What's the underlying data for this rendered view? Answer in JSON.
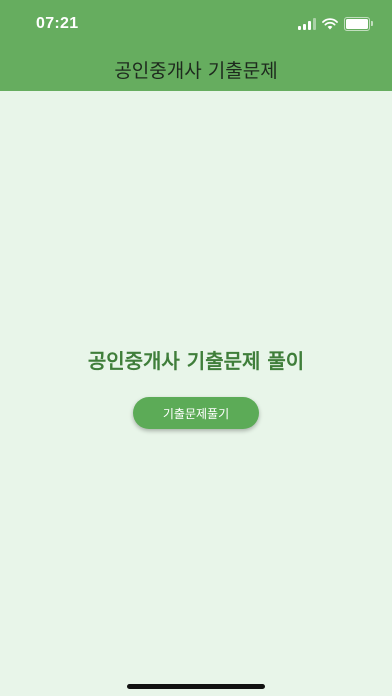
{
  "status_bar": {
    "time": "07:21",
    "icons": [
      "cellular-signal-icon",
      "wifi-icon",
      "battery-icon"
    ]
  },
  "app_bar": {
    "title": "공인중개사 기출문제"
  },
  "main": {
    "headline": "공인중개사 기출문제 풀이",
    "start_button_label": "기출문제풀기"
  },
  "colors": {
    "app_bar": "#66ad5f",
    "background": "#e8f5e9",
    "headline": "#3f7e3a",
    "button": "#5cab57"
  }
}
